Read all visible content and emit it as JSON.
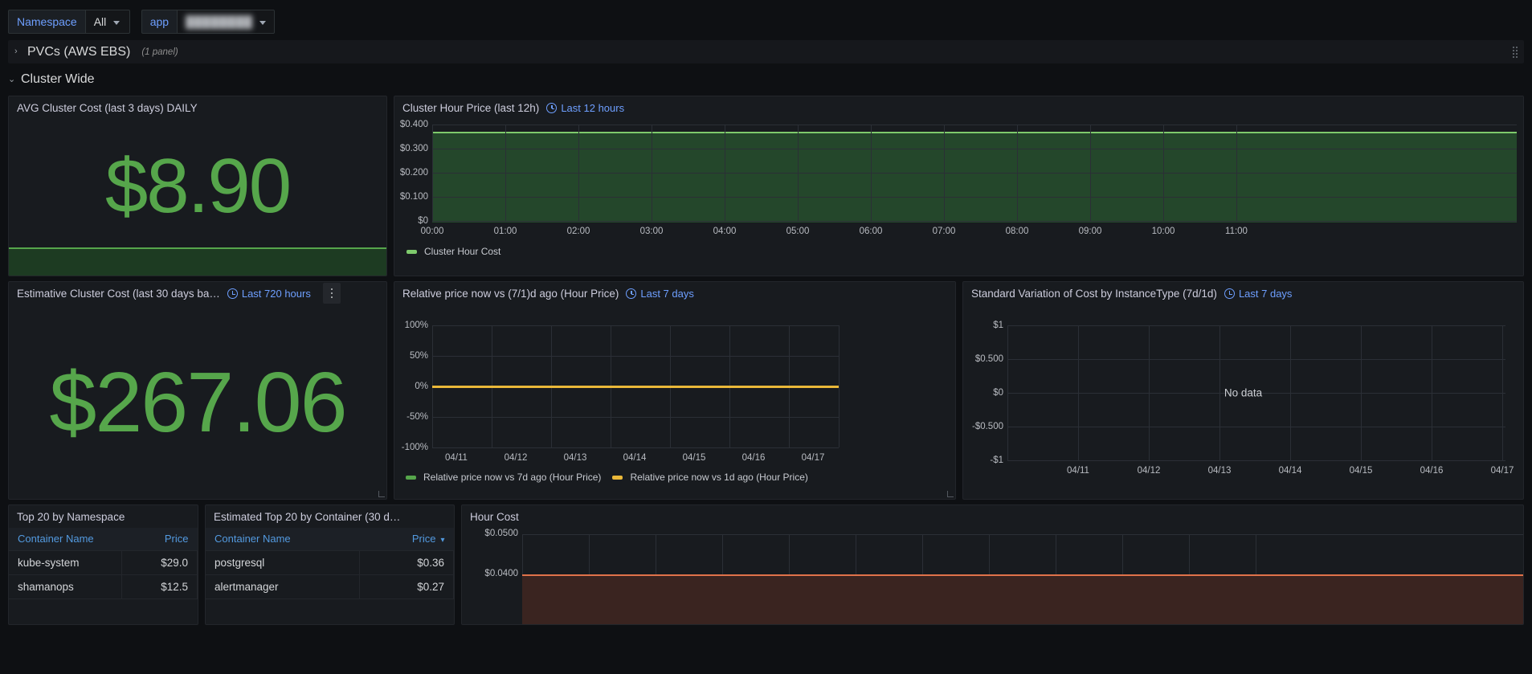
{
  "variables": [
    {
      "label": "Namespace",
      "value": "All",
      "redacted": false,
      "name": "namespace"
    },
    {
      "label": "app",
      "value": "████████",
      "redacted": true,
      "name": "app"
    }
  ],
  "rows": [
    {
      "title": "PVCs (AWS EBS)",
      "panel_count": "(1 panel)",
      "collapsed": true,
      "chevron": "›"
    },
    {
      "title": "Cluster Wide",
      "panel_count": "",
      "collapsed": false,
      "chevron": "⌄"
    }
  ],
  "colors": {
    "green": "#56a64b",
    "green_light": "#7eca6c",
    "green_fill": "#24472b",
    "yellow": "#eab839",
    "orange": "#e0724a",
    "orange_fill": "#3a2420",
    "blue": "#6e9fff",
    "link_blue": "#539ae0",
    "panel_bg": "#181b1f",
    "page_bg": "#0e1013"
  },
  "panels": {
    "avg_cluster_cost": {
      "title": "AVG Cluster Cost (last 3 days) DAILY",
      "value": "$8.90"
    },
    "cluster_hour_price": {
      "title": "Cluster Hour Price (last 12h)",
      "time_range": "Last 12 hours"
    },
    "estimative_cluster_cost": {
      "title": "Estimative Cluster Cost (last 30 days ba…",
      "time_range": "Last 720 hours",
      "value": "$267.06"
    },
    "relative_price": {
      "title": "Relative price now vs (7/1)d ago (Hour Price)",
      "time_range": "Last 7 days"
    },
    "standard_variation": {
      "title": "Standard Variation of Cost by InstanceType (7d/1d)",
      "time_range": "Last 7 days",
      "no_data": "No data"
    },
    "top20_namespace": {
      "title": "Top 20 by Namespace",
      "columns": [
        "Container Name",
        "Price"
      ],
      "rows": [
        {
          "name": "kube-system",
          "price": "$29.0"
        },
        {
          "name": "shamanops",
          "price": "$12.5"
        }
      ]
    },
    "estimated_top20_container": {
      "title": "Estimated Top 20 by Container (30 d…",
      "columns": [
        "Container Name",
        "Price"
      ],
      "sorted_column": "Price",
      "rows": [
        {
          "name": "postgresql",
          "price": "$0.36"
        },
        {
          "name": "alertmanager",
          "price": "$0.27"
        }
      ]
    },
    "hour_cost": {
      "title": "Hour Cost"
    }
  },
  "chart_data": [
    {
      "id": "cluster_hour_price",
      "type": "area",
      "title": "Cluster Hour Price (last 12h)",
      "xlabel": "",
      "ylabel": "",
      "ylim": [
        0,
        0.4
      ],
      "ytick_labels": [
        "$0.400",
        "$0.300",
        "$0.200",
        "$0.100",
        "$0"
      ],
      "ytick_values": [
        0.4,
        0.3,
        0.2,
        0.1,
        0
      ],
      "grid": true,
      "legend_position": "bottom",
      "series": [
        {
          "name": "Cluster Hour Cost",
          "color": "#7eca6c",
          "x": [
            "00:00",
            "01:00",
            "02:00",
            "03:00",
            "04:00",
            "05:00",
            "06:00",
            "07:00",
            "08:00",
            "09:00",
            "10:00",
            "11:00"
          ],
          "values": [
            0.375,
            0.375,
            0.375,
            0.375,
            0.375,
            0.375,
            0.375,
            0.375,
            0.375,
            0.375,
            0.375,
            0.375
          ]
        }
      ],
      "xtick_labels": [
        "00:00",
        "01:00",
        "02:00",
        "03:00",
        "04:00",
        "05:00",
        "06:00",
        "07:00",
        "08:00",
        "09:00",
        "10:00",
        "11:00"
      ]
    },
    {
      "id": "relative_price",
      "type": "line",
      "title": "Relative price now vs (7/1)d ago (Hour Price)",
      "xlabel": "",
      "ylabel": "",
      "ylim": [
        -100,
        100
      ],
      "ytick_labels": [
        "100%",
        "50%",
        "0%",
        "-50%",
        "-100%"
      ],
      "ytick_values": [
        100,
        50,
        0,
        -50,
        -100
      ],
      "grid": true,
      "legend_position": "bottom",
      "xtick_labels": [
        "04/11",
        "04/12",
        "04/13",
        "04/14",
        "04/15",
        "04/16",
        "04/17"
      ],
      "series": [
        {
          "name": "Relative price now vs 7d ago (Hour Price)",
          "color": "#56a64b",
          "values": [
            0,
            0,
            0,
            0,
            0,
            0,
            0
          ]
        },
        {
          "name": "Relative price now vs 1d ago (Hour Price)",
          "color": "#eab839",
          "values": [
            0,
            0,
            0,
            0,
            0,
            0,
            0
          ]
        }
      ]
    },
    {
      "id": "standard_variation",
      "type": "line",
      "title": "Standard Variation of Cost by InstanceType (7d/1d)",
      "xlabel": "",
      "ylabel": "",
      "ylim": [
        -1,
        1
      ],
      "ytick_labels": [
        "$1",
        "$0.500",
        "$0",
        "-$0.500",
        "-$1"
      ],
      "ytick_values": [
        1,
        0.5,
        0,
        -0.5,
        -1
      ],
      "grid": true,
      "xtick_labels": [
        "04/11",
        "04/12",
        "04/13",
        "04/14",
        "04/15",
        "04/16",
        "04/17"
      ],
      "series": [],
      "annotation": "No data"
    },
    {
      "id": "hour_cost",
      "type": "area",
      "title": "Hour Cost",
      "xlabel": "",
      "ylabel": "",
      "ylim": [
        0,
        0.05
      ],
      "ytick_labels": [
        "$0.0500",
        "$0.0400"
      ],
      "ytick_values": [
        0.05,
        0.04
      ],
      "grid": true,
      "series": [
        {
          "name": "Hour Cost",
          "color": "#e0724a",
          "values": [
            0.04,
            0.04,
            0.04,
            0.04,
            0.04,
            0.04
          ]
        }
      ]
    },
    {
      "id": "top20_namespace",
      "type": "table",
      "title": "Top 20 by Namespace",
      "columns": [
        "Container Name",
        "Price"
      ],
      "rows": [
        [
          "kube-system",
          "$29.0"
        ],
        [
          "shamanops",
          "$12.5"
        ]
      ]
    },
    {
      "id": "estimated_top20_container",
      "type": "table",
      "title": "Estimated Top 20 by Container (30 d…",
      "columns": [
        "Container Name",
        "Price"
      ],
      "rows": [
        [
          "postgresql",
          "$0.36"
        ],
        [
          "alertmanager",
          "$0.27"
        ]
      ]
    }
  ]
}
